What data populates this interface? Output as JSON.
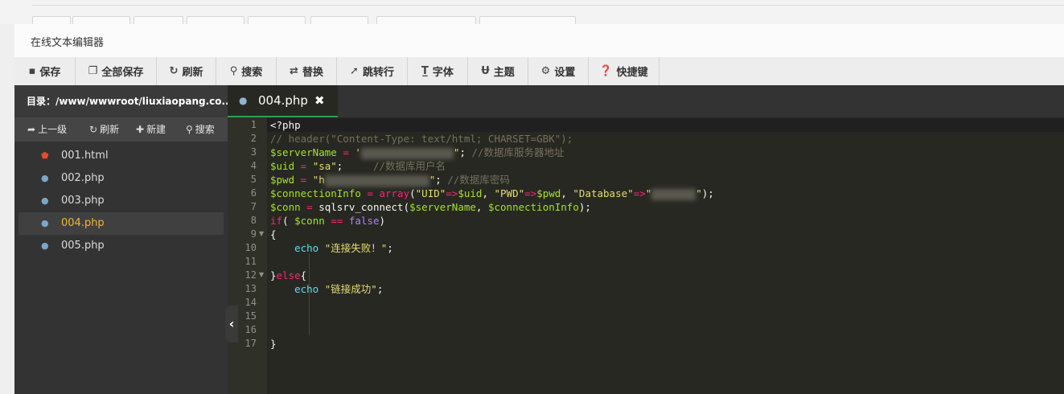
{
  "window": {
    "title": "在线文本编辑器"
  },
  "toolbar": {
    "save": "保存",
    "save_all": "全部保存",
    "refresh": "刷新",
    "search": "搜索",
    "replace": "替换",
    "goto": "跳转行",
    "font": "字体",
    "theme": "主题",
    "settings": "设置",
    "shortcuts": "快捷键"
  },
  "sidebar": {
    "directory": "目录：/www/wwwroot/liuxiaopang.co...",
    "actions": {
      "up": "上一级",
      "refresh": "刷新",
      "new": "新建",
      "search": "搜索"
    },
    "files": [
      {
        "name": "001.html",
        "icon": "html5-icon"
      },
      {
        "name": "002.php",
        "icon": "php-elephant-icon"
      },
      {
        "name": "003.php",
        "icon": "php-elephant-icon"
      },
      {
        "name": "004.php",
        "icon": "php-elephant-icon",
        "active": true
      },
      {
        "name": "005.php",
        "icon": "php-elephant-icon"
      }
    ]
  },
  "editor": {
    "tab_name": "004.php",
    "line_numbers": [
      "1",
      "2",
      "3",
      "4",
      "5",
      "6",
      "7",
      "8",
      "9",
      "10",
      "11",
      "12",
      "13",
      "14",
      "15",
      "16",
      "17"
    ],
    "code": {
      "l1": "<?php",
      "l2": "// header(\"Content-Type: text/html; CHARSET=GBK\");",
      "l3_var": "$serverName",
      "l3_eq": " = ",
      "l3_q1": "'",
      "l3_q2": "\"",
      "l3_end": "; ",
      "l3_cm": "//数据库服务器地址",
      "l4_var": "$uid",
      "l4_eq": " = ",
      "l4_str": "\"sa\"",
      "l4_end": ";     ",
      "l4_cm": "//数据库用户名",
      "l5_var": "$pwd",
      "l5_eq": " = ",
      "l5_str": "\"h",
      "l5_q2": "\"",
      "l5_end": "; ",
      "l5_cm": "//数据库密码",
      "l6_var": "$connectionInfo",
      "l6_eq": " = ",
      "l6_fn": "array",
      "l6_p1": "(",
      "l6_k1": "\"UID\"",
      "l6_ar": "=>",
      "l6_v1": "$uid",
      "l6_c": ", ",
      "l6_k2": "\"PWD\"",
      "l6_v2": "$pwd",
      "l6_k3": "\"Database\"",
      "l6_q3": "\"",
      "l6_q4": "\"",
      "l6_end": ");",
      "l7_var": "$conn",
      "l7_eq": " = ",
      "l7_fn": "sqlsrv_connect(",
      "l7_a1": "$serverName",
      "l7_c": ", ",
      "l7_a2": "$connectionInfo",
      "l7_end": ");",
      "l8_kw": "if",
      "l8_p": "( ",
      "l8_var": "$conn",
      "l8_op": " == ",
      "l8_bo": "false",
      "l8_end": ")",
      "l9": "{",
      "l10_fn": "echo",
      "l10_str": "\"连接失败！\"",
      "l10_end": ";",
      "l12_b": "}",
      "l12_kw": "else",
      "l12_o": "{",
      "l13_fn": "echo",
      "l13_str": "\"链接成功\"",
      "l13_end": ";",
      "l17": "}"
    }
  },
  "colors": {
    "editor_bg": "#272822",
    "accent_green": "#2aa14b",
    "active_file": "#f2b538"
  }
}
